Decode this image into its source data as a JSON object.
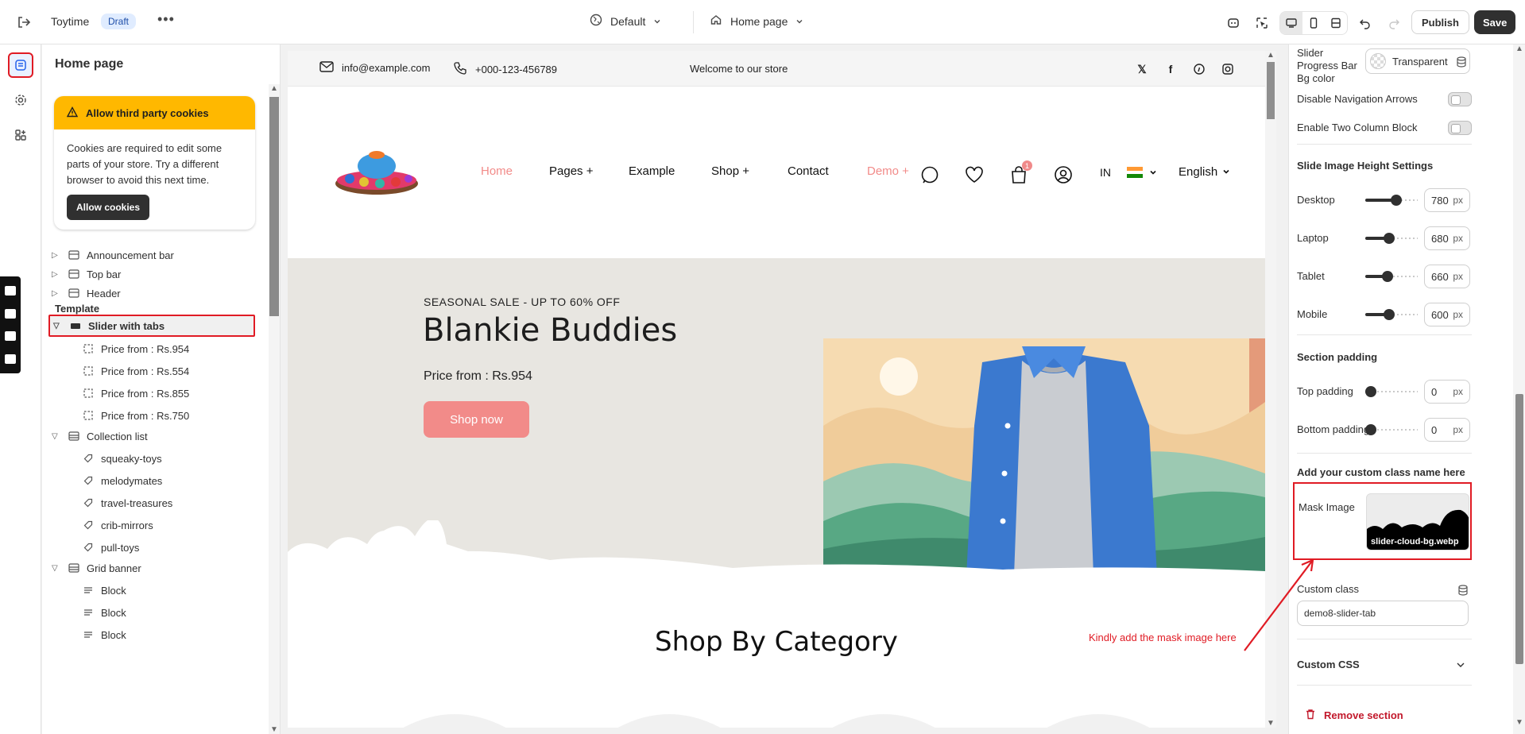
{
  "topbar": {
    "store_name": "Toytime",
    "status_badge": "Draft",
    "more": "•••",
    "theme": "Default",
    "page": "Home page",
    "publish": "Publish",
    "save": "Save"
  },
  "sidebar": {
    "title": "Home page",
    "cookie": {
      "heading": "Allow third party cookies",
      "body": "Cookies are required to edit some parts of your store. Try a different browser to avoid this next time.",
      "button": "Allow cookies"
    },
    "header_items": [
      "Announcement bar",
      "Top bar",
      "Header"
    ],
    "template_heading": "Template",
    "sections": [
      {
        "label": "Slider with tabs",
        "children": [
          "Price from : Rs.954",
          "Price from : Rs.554",
          "Price from : Rs.855",
          "Price from : Rs.750"
        ]
      },
      {
        "label": "Collection list",
        "children": [
          "squeaky-toys",
          "melodymates",
          "travel-treasures",
          "crib-mirrors",
          "pull-toys"
        ]
      },
      {
        "label": "Grid banner",
        "children": [
          "Block",
          "Block",
          "Block"
        ]
      }
    ]
  },
  "preview": {
    "announcement": {
      "email": "info@example.com",
      "phone": "+000-123-456789",
      "welcome": "Welcome to our store"
    },
    "nav": [
      "Home",
      "Pages +",
      "Example",
      "Shop +",
      "Contact",
      "Demo +"
    ],
    "cart_count": "1",
    "country": "IN",
    "language": "English",
    "hero": {
      "eyebrow": "SEASONAL SALE - UP TO 60% OFF",
      "title": "Blankie Buddies",
      "price": "Price from : Rs.954",
      "button": "Shop now"
    },
    "section_title": "Shop By Category"
  },
  "panel": {
    "progress_bg_label": "Slider Progress Bar Bg color",
    "progress_bg_value": "Transparent",
    "disable_arrows": "Disable Navigation Arrows",
    "two_column": "Enable Two Column Block",
    "height_heading": "Slide Image Height Settings",
    "heights": [
      {
        "label": "Desktop",
        "value": "780",
        "unit": "px",
        "fraction": 0.62
      },
      {
        "label": "Laptop",
        "value": "680",
        "unit": "px",
        "fraction": 0.44
      },
      {
        "label": "Tablet",
        "value": "660",
        "unit": "px",
        "fraction": 0.4
      },
      {
        "label": "Mobile",
        "value": "600",
        "unit": "px",
        "fraction": 0.44
      }
    ],
    "padding_heading": "Section padding",
    "paddings": [
      {
        "label": "Top padding",
        "value": "0",
        "unit": "px",
        "fraction": 0.0
      },
      {
        "label": "Bottom padding",
        "value": "0",
        "unit": "px",
        "fraction": 0.0
      }
    ],
    "custom_class_heading": "Add your custom class name here",
    "mask_label": "Mask Image",
    "mask_file": "slider-cloud-bg.webp",
    "custom_class_label": "Custom class",
    "custom_class_value": "demo8-slider-tab",
    "custom_css": "Custom CSS",
    "remove": "Remove section"
  },
  "annotation": "Kindly add the mask image here",
  "colors": {
    "accent_red": "#e01b24",
    "hero_button": "#f28b89",
    "cookie_banner": "#ffb800",
    "nav_active": "#f28b89"
  }
}
